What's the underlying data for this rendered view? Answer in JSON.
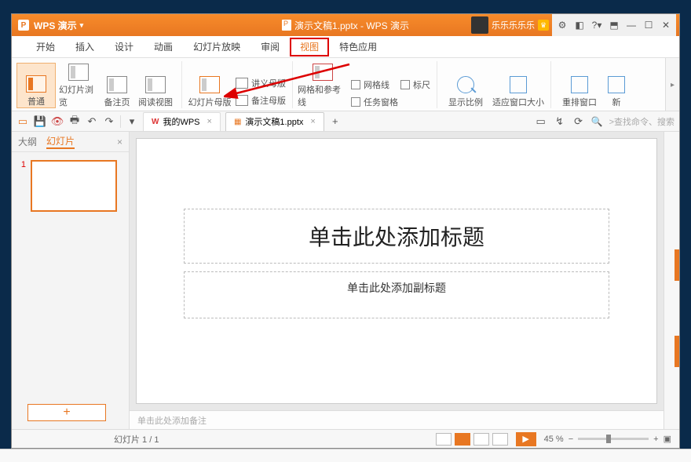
{
  "titlebar": {
    "app_name": "WPS 演示",
    "logo_letter": "P",
    "doc_title": "演示文稿1.pptx - WPS 演示",
    "username": "乐乐乐乐乐"
  },
  "menubar": {
    "items": [
      "开始",
      "插入",
      "设计",
      "动画",
      "幻灯片放映",
      "审阅",
      "视图",
      "特色应用"
    ],
    "active_index": 6
  },
  "ribbon": {
    "normal": "普通",
    "slide_browse": "幻灯片浏览",
    "notes_page": "备注页",
    "reading_view": "阅读视图",
    "slide_master": "幻灯片母版",
    "handout_master": "讲义母版",
    "notes_master": "备注母版",
    "grid_guides": "网格和参考线",
    "gridlines": "网格线",
    "ruler": "标尺",
    "task_pane": "任务窗格",
    "zoom": "显示比例",
    "fit_window": "适应窗口大小",
    "arrange_windows": "重排窗口",
    "new_window": "新"
  },
  "quickbar": {
    "tab_wps": "我的WPS",
    "tab_doc": "演示文稿1.pptx",
    "search_placeholder": "查找命令、搜索"
  },
  "sidepanel": {
    "outline": "大纲",
    "slides": "幻灯片",
    "slide_number": "1"
  },
  "slide": {
    "title_placeholder": "单击此处添加标题",
    "subtitle_placeholder": "单击此处添加副标题"
  },
  "notes": {
    "placeholder": "单击此处添加备注"
  },
  "statusbar": {
    "page_info": "幻灯片 1 / 1",
    "zoom_value": "45 %"
  }
}
